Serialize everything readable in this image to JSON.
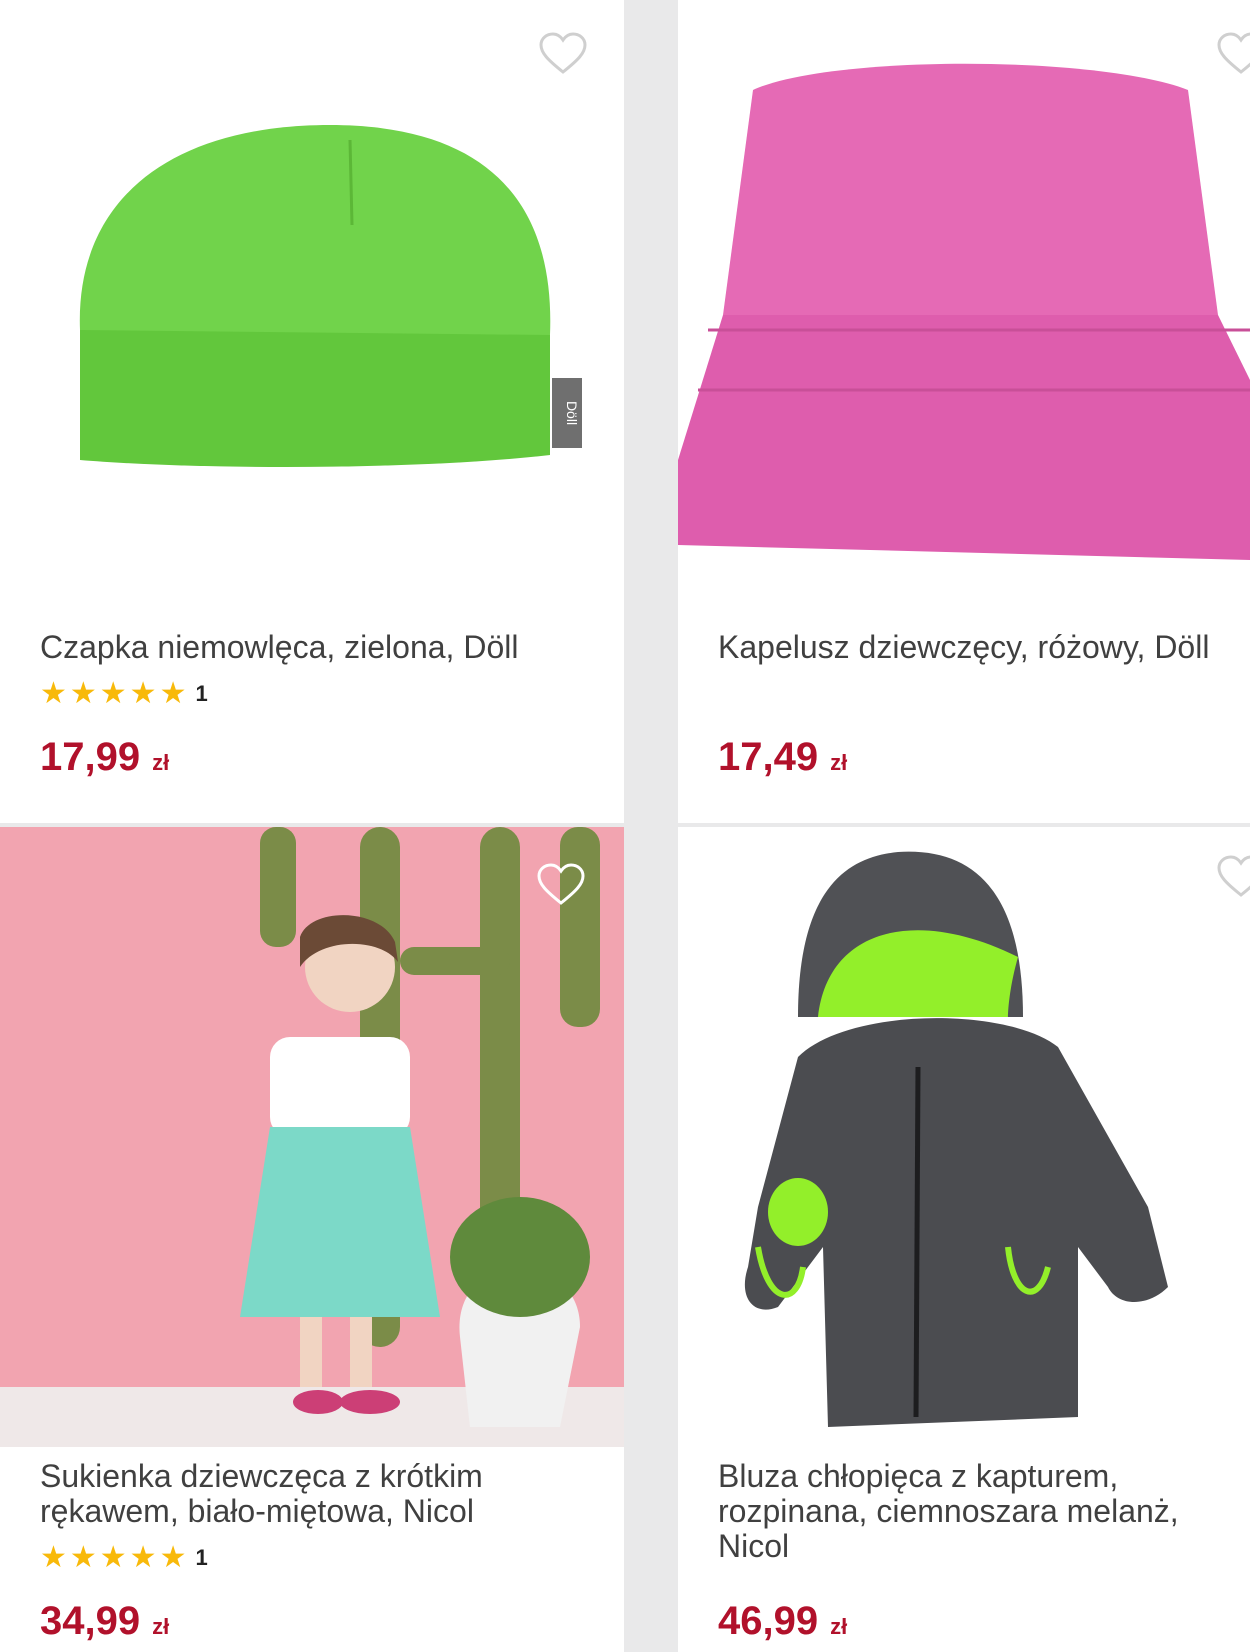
{
  "products": [
    {
      "name": "Czapka niemowlęca, zielona, Döll",
      "rating_count": "1",
      "stars": "★★★★★",
      "rating": 5,
      "price": "17,99",
      "currency": "zł",
      "brand_tag": "Döll",
      "favorited": false
    },
    {
      "name": "Kapelusz dziewczęcy, różowy, Döll",
      "price": "17,49",
      "currency": "zł",
      "favorited": false
    },
    {
      "name": "Sukienka dziewczęca z krótkim rękawem, biało-miętowa, Nicol",
      "rating_count": "1",
      "stars": "★★★★★",
      "rating": 5,
      "price": "34,99",
      "currency": "zł",
      "favorited": false
    },
    {
      "name": "Bluza chłopięca z kapturem, rozpinana, ciemnoszara melanż, Nicol",
      "price": "46,99",
      "currency": "zł",
      "favorited": false
    }
  ],
  "colors": {
    "price": "#b1112b",
    "star": "#f8b90a",
    "background": "#e9e9ea",
    "card": "#ffffff"
  },
  "icons": {
    "favorite": "heart-outline-icon",
    "rating": "star-icon"
  }
}
